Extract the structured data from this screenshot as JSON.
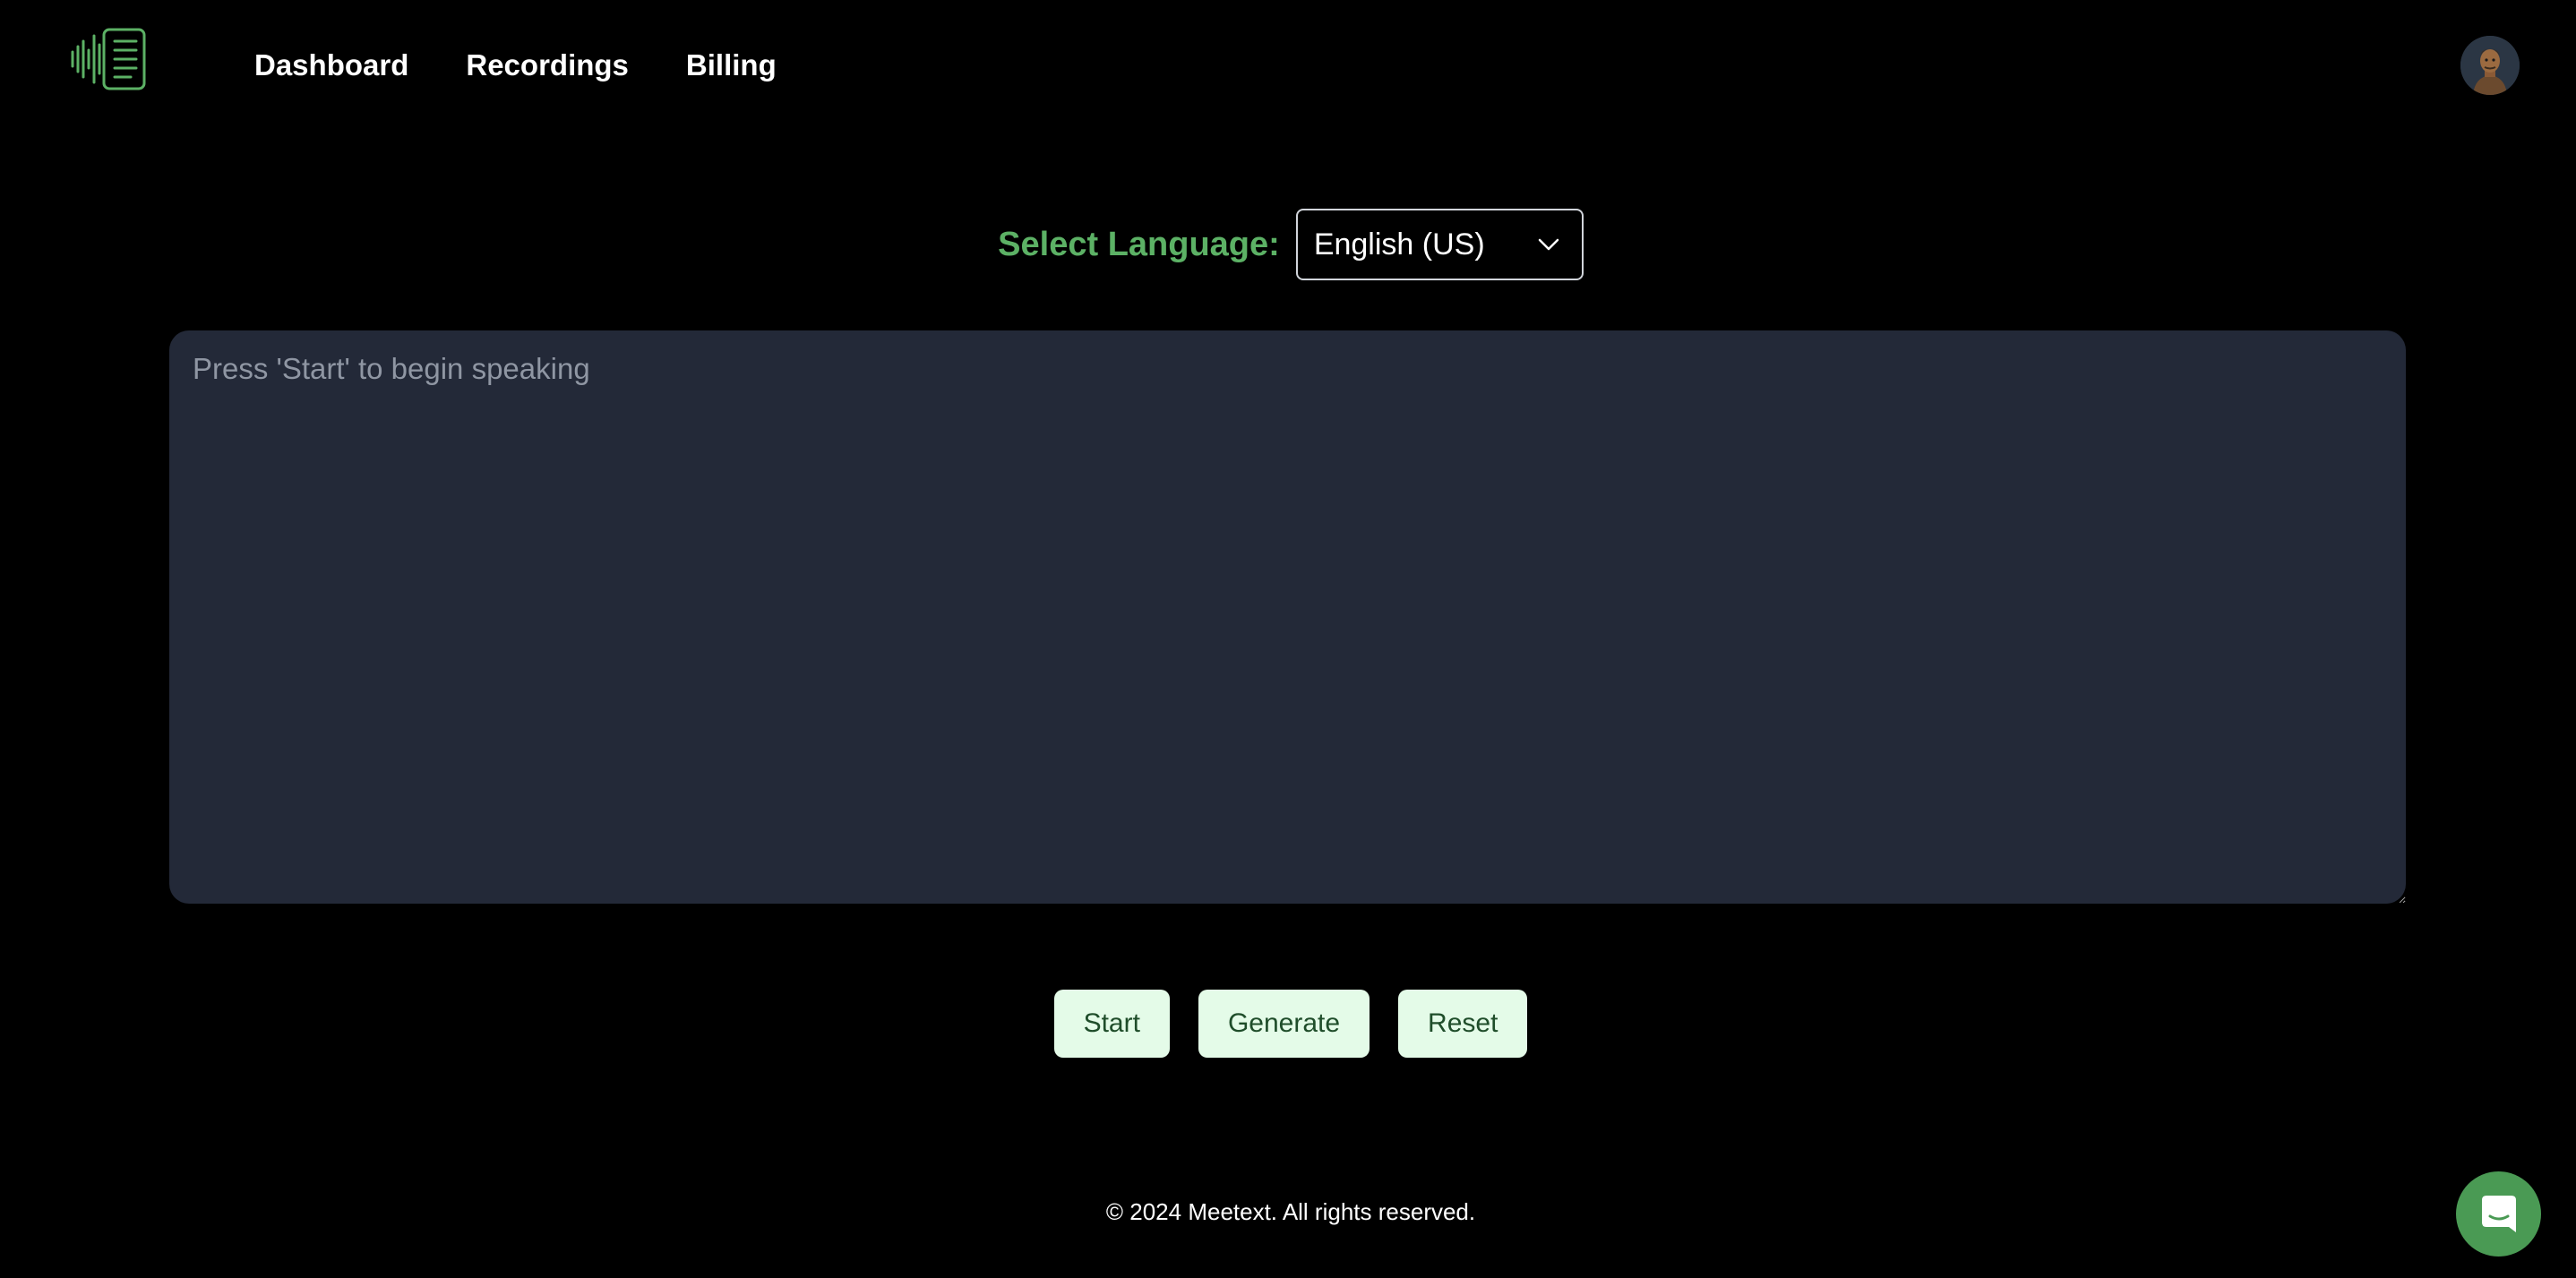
{
  "nav": {
    "logo_icon": "waveform-document-icon",
    "items": [
      {
        "label": "Dashboard"
      },
      {
        "label": "Recordings"
      },
      {
        "label": "Billing"
      }
    ],
    "avatar_icon": "user-avatar"
  },
  "language": {
    "label": "Select Language:",
    "selected": "English (US)",
    "dropdown_icon": "chevron-down-icon"
  },
  "transcript": {
    "value": "",
    "placeholder": "Press 'Start' to begin speaking"
  },
  "actions": {
    "start_label": "Start",
    "generate_label": "Generate",
    "reset_label": "Reset"
  },
  "footer": {
    "text": "© 2024 Meetext. All rights reserved."
  },
  "chat": {
    "icon": "chat-icon"
  },
  "colors": {
    "background": "#000000",
    "accent_green": "#5cb165",
    "textarea_bg": "#232938",
    "button_bg": "#e4fbe8",
    "button_text": "#1f4d2a",
    "chat_bg": "#4a9a54"
  }
}
